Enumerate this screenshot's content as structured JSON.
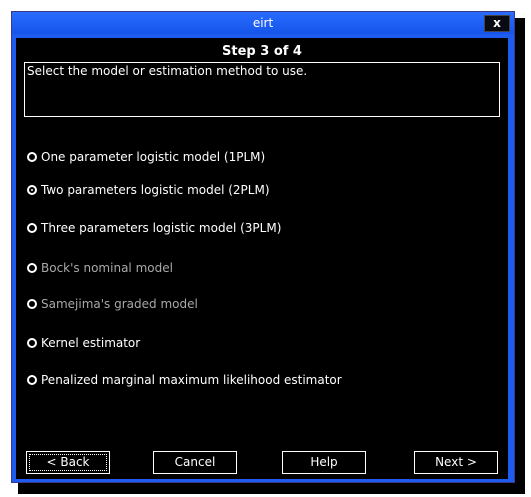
{
  "window": {
    "title": "eirt",
    "close_label": "x"
  },
  "wizard": {
    "step_label": "Step 3 of 4",
    "description": "Select the model or estimation method to use."
  },
  "options": [
    {
      "label": "One parameter logistic model (1PLM)",
      "selected": false,
      "enabled": true
    },
    {
      "label": "Two parameters logistic model (2PLM)",
      "selected": true,
      "enabled": true
    },
    {
      "label": "Three parameters logistic model (3PLM)",
      "selected": false,
      "enabled": true
    },
    {
      "label": "Bock's nominal model",
      "selected": false,
      "enabled": false
    },
    {
      "label": "Samejima's graded model",
      "selected": false,
      "enabled": false
    },
    {
      "label": "Kernel estimator",
      "selected": false,
      "enabled": true
    },
    {
      "label": "Penalized marginal maximum likelihood estimator",
      "selected": false,
      "enabled": true
    }
  ],
  "buttons": {
    "back": "< Back",
    "cancel": "Cancel",
    "help": "Help",
    "next": "Next >"
  },
  "colors": {
    "frame_blue": "#1e5cf0",
    "background": "#000000",
    "text": "#ffffff",
    "disabled_text": "#a8a8a8"
  }
}
